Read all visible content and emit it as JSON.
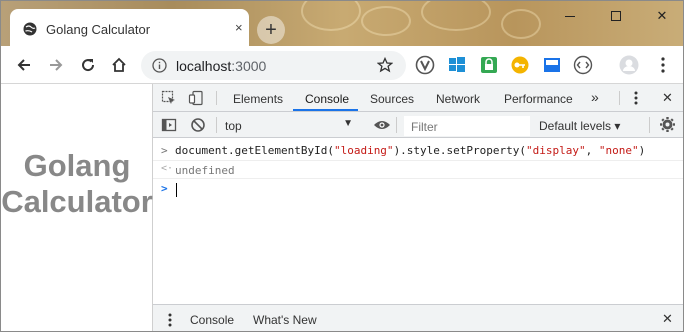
{
  "window": {
    "tab_title": "Golang Calculator",
    "tab_close": "×",
    "new_tab": "+",
    "controls": {
      "minimize": "—",
      "maximize": "☐",
      "close": "✕"
    }
  },
  "toolbar": {
    "url_host": "localhost",
    "url_port": ":3000"
  },
  "page": {
    "heading_line1": "Golang",
    "heading_line2": "Calculator"
  },
  "devtools": {
    "tabs": [
      "Elements",
      "Console",
      "Sources",
      "Network",
      "Performance"
    ],
    "active_tab": "Console",
    "more_tabs": "»",
    "close": "✕",
    "context": "top",
    "filter_placeholder": "Filter",
    "levels": "Default levels ▾",
    "console": {
      "input_prompt": ">",
      "output_prompt": "<·",
      "command_prefix": "document.getElementById(",
      "command_arg1": "\"loading\"",
      "command_middle": ").style.setProperty(",
      "command_arg2": "\"display\"",
      "command_comma": ", ",
      "command_arg3": "\"none\"",
      "command_suffix": ")",
      "result": "undefined"
    },
    "drawer_tabs": [
      "Console",
      "What's New"
    ],
    "drawer_active": "Console"
  },
  "colors": {
    "accent": "#1a73e8",
    "string": "#c41a16",
    "muted_heading": "#888888",
    "titlebar": "#b89a66"
  }
}
